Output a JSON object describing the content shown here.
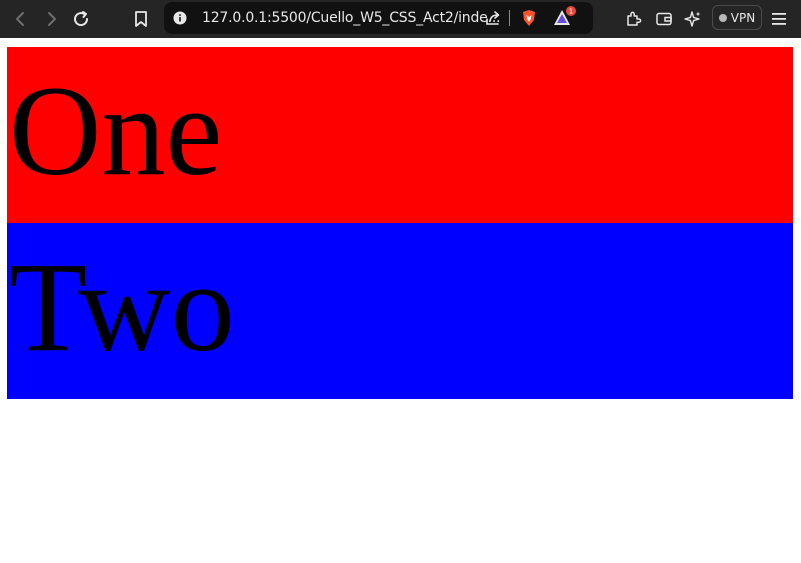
{
  "browser": {
    "url": "127.0.0.1:5500/Cuello_W5_CSS_Act2/inde...",
    "vpn_label": "VPN",
    "icons": [
      "back-icon",
      "forward-icon",
      "reload-icon",
      "bookmark-icon",
      "info-icon",
      "share-icon",
      "brave-shield-icon",
      "brave-rewards-icon",
      "extensions-icon",
      "wallet-icon",
      "leo-ai-icon",
      "menu-icon"
    ],
    "rewards_badge": "1"
  },
  "page": {
    "blocks": [
      {
        "text": "One",
        "color": "#ff0000"
      },
      {
        "text": "Two",
        "color": "#0000ff"
      }
    ]
  }
}
